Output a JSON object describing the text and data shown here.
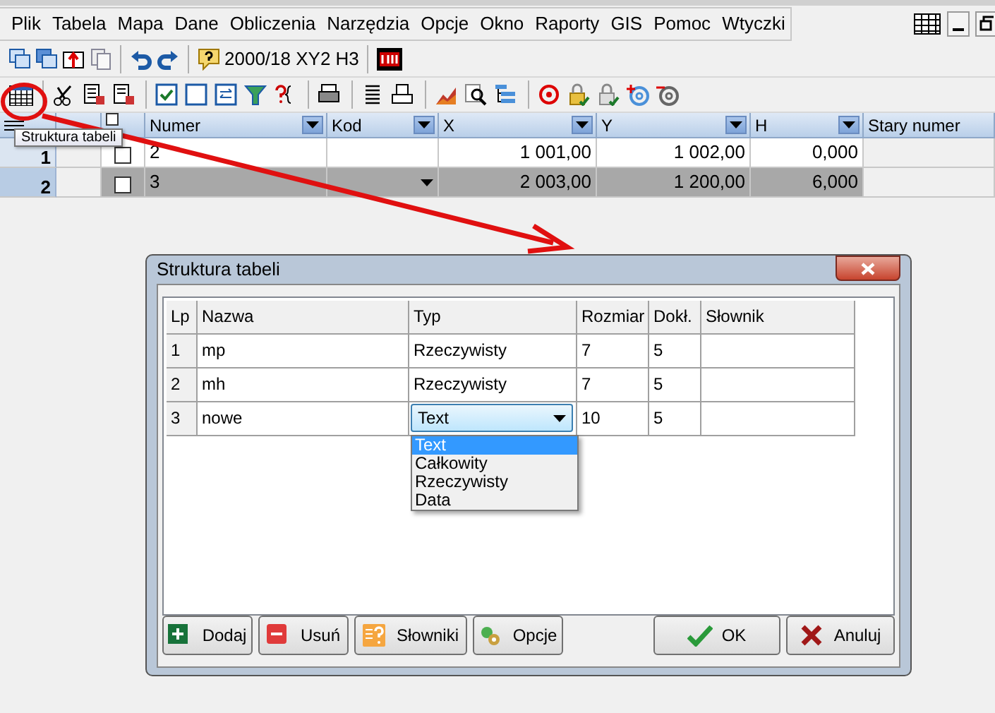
{
  "menu": [
    "Plik",
    "Tabela",
    "Mapa",
    "Dane",
    "Obliczenia",
    "Narzędzia",
    "Opcje",
    "Okno",
    "Raporty",
    "GIS",
    "Pomoc",
    "Wtyczki"
  ],
  "toolbar": {
    "project_label": "2000/18 XY2 H3"
  },
  "tooltip": "Struktura tabeli",
  "header_checkbox": {
    "checked": false
  },
  "grid": {
    "columns": [
      {
        "label": "Numer",
        "filter": true
      },
      {
        "label": "Kod",
        "filter": true
      },
      {
        "label": "X",
        "filter": true
      },
      {
        "label": "Y",
        "filter": true
      },
      {
        "label": "H",
        "filter": true
      },
      {
        "label": "Stary numer",
        "filter": false
      }
    ],
    "rows": [
      {
        "indicator": "1",
        "selected": false,
        "checked": false,
        "cells": [
          "2",
          "",
          "1 001,00",
          "1 002,00",
          "0,000",
          ""
        ],
        "kod_dropdown": false
      },
      {
        "indicator": "2",
        "selected": true,
        "checked": false,
        "cells": [
          "3",
          "",
          "2 003,00",
          "1 200,00",
          "6,000",
          ""
        ],
        "kod_dropdown": true
      }
    ]
  },
  "dialog": {
    "title": "Struktura tabeli",
    "columns": [
      "Lp",
      "Nazwa",
      "Typ",
      "Rozmiar",
      "Dokł.",
      "Słownik"
    ],
    "rows": [
      {
        "cells": [
          "1",
          "mp",
          "Rzeczywisty",
          "7",
          "5",
          ""
        ],
        "type_dropdown": false
      },
      {
        "cells": [
          "2",
          "mh",
          "Rzeczywisty",
          "7",
          "5",
          ""
        ],
        "type_dropdown": false
      },
      {
        "cells": [
          "3",
          "nowe",
          "Text",
          "10",
          "5",
          ""
        ],
        "type_dropdown": true
      }
    ],
    "dropdown_options": [
      {
        "label": "Text",
        "selected": true
      },
      {
        "label": "Całkowity",
        "selected": false
      },
      {
        "label": "Rzeczywisty",
        "selected": false
      },
      {
        "label": "Data",
        "selected": false
      }
    ],
    "buttons": [
      {
        "label": "Dodaj",
        "kind": "add"
      },
      {
        "label": "Usuń",
        "kind": "remove"
      },
      {
        "label": "Słowniki",
        "kind": "dictionary"
      },
      {
        "label": "Opcje",
        "kind": "options"
      },
      {
        "label": "OK",
        "kind": "ok"
      },
      {
        "label": "Anuluj",
        "kind": "cancel"
      }
    ]
  }
}
